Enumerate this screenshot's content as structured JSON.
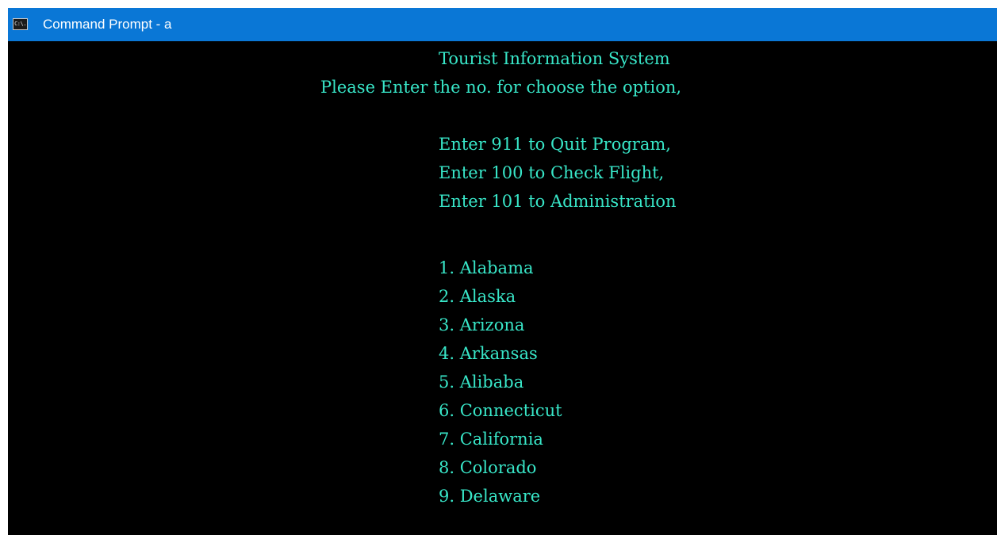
{
  "window": {
    "title": "Command Prompt - a",
    "icon": "cmd-icon",
    "icon_text": "C:\\."
  },
  "colors": {
    "titlebar": "#0a77d6",
    "console_bg": "#000000",
    "console_text": "#38e6c8"
  },
  "console": {
    "heading": "Tourist Information System",
    "instruction": "Please Enter the no. for choose the option,",
    "options": [
      "Enter 911 to Quit Program,",
      "Enter 100 to Check Flight,",
      "Enter 101 to Administration"
    ],
    "states": [
      "1. Alabama",
      "2. Alaska",
      "3. Arizona",
      "4. Arkansas",
      "5. Alibaba",
      "6. Connecticut",
      "7. California",
      "8. Colorado",
      "9. Delaware"
    ]
  }
}
